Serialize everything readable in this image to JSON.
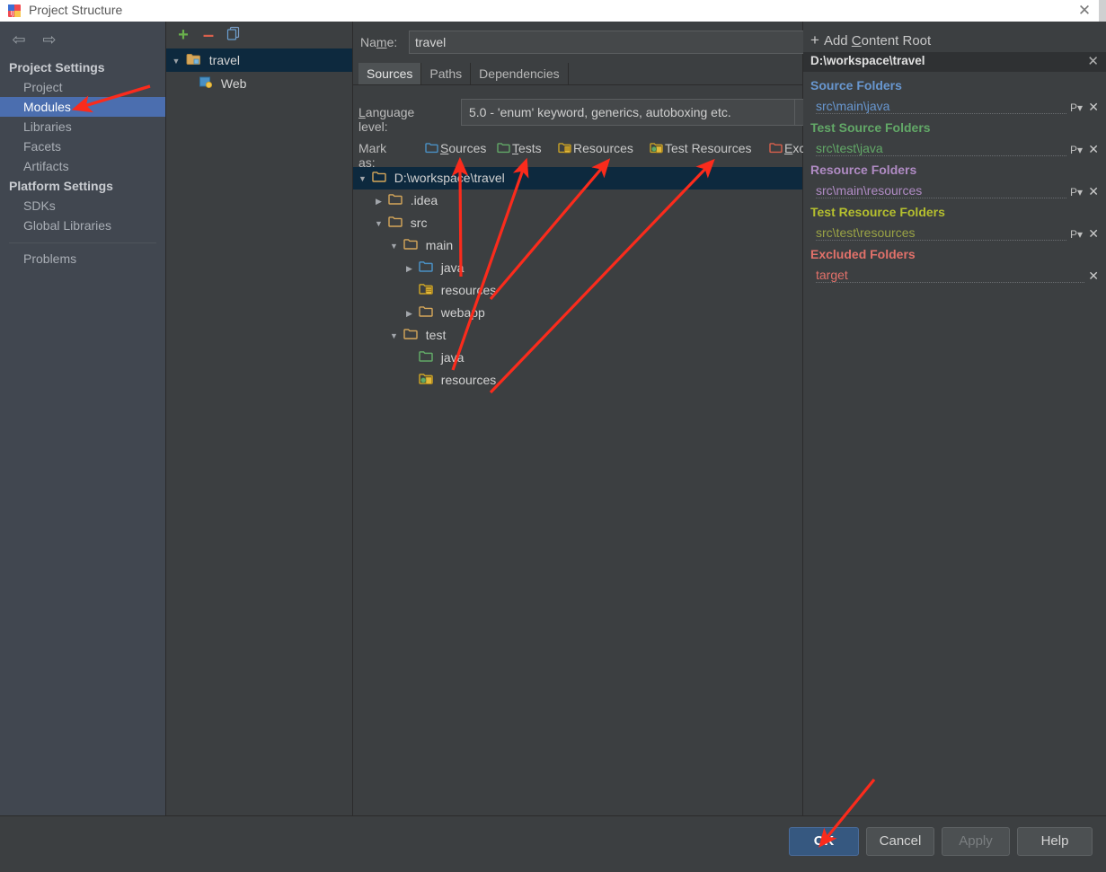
{
  "window": {
    "title": "Project Structure",
    "app_icon": "intellij-idea-icon",
    "close_label": "✕"
  },
  "nav": {
    "back_icon": "⇦",
    "forward_icon": "⇨"
  },
  "sidebar": {
    "groups": [
      {
        "label": "Project Settings",
        "items": [
          {
            "label": "Project",
            "selected": false
          },
          {
            "label": "Modules",
            "selected": true
          },
          {
            "label": "Libraries",
            "selected": false
          },
          {
            "label": "Facets",
            "selected": false
          },
          {
            "label": "Artifacts",
            "selected": false
          }
        ]
      },
      {
        "label": "Platform Settings",
        "items": [
          {
            "label": "SDKs",
            "selected": false
          },
          {
            "label": "Global Libraries",
            "selected": false
          }
        ]
      }
    ],
    "problems_label": "Problems"
  },
  "modules_panel": {
    "toolbar": {
      "add_label": "+",
      "remove_label": "–",
      "copy_label": "copy-icon"
    },
    "tree": [
      {
        "label": "travel",
        "icon": "module-folder-icon",
        "expanded": true,
        "selected": true,
        "indent": 0
      },
      {
        "label": "Web",
        "icon": "web-facet-icon",
        "expanded": null,
        "selected": false,
        "indent": 1
      }
    ]
  },
  "module_editor": {
    "name_label": "Name:",
    "name_mnemonic": "m",
    "name_value": "travel",
    "tabs": [
      {
        "label": "Sources",
        "active": true
      },
      {
        "label": "Paths",
        "active": false
      },
      {
        "label": "Dependencies",
        "active": false
      }
    ],
    "language_level": {
      "label": "Language level:",
      "value": "5.0 - 'enum' keyword, generics, autoboxing etc.",
      "arrow": "▼"
    },
    "mark_as": {
      "label": "Mark as:",
      "options": [
        {
          "label": "Sources",
          "mnemonic": "S",
          "color": "#4a90c4",
          "icon": "folder-sources-icon"
        },
        {
          "label": "Tests",
          "mnemonic": "T",
          "color": "#62a867",
          "icon": "folder-tests-icon"
        },
        {
          "label": "Resources",
          "mnemonic": "R",
          "color": "#c9a227",
          "icon": "folder-resources-icon"
        },
        {
          "label": "Test Resources",
          "mnemonic": "",
          "color": "#c9a227",
          "icon": "folder-test-resources-icon"
        },
        {
          "label": "Excluded",
          "mnemonic": "E",
          "color": "#d9604c",
          "icon": "folder-excluded-icon"
        }
      ]
    },
    "content_tree": [
      {
        "label": "D:\\workspace\\travel",
        "indent": 0,
        "expanded": true,
        "selected": true,
        "folder": "plain",
        "color": "#d2d2d2"
      },
      {
        "label": ".idea",
        "indent": 1,
        "expanded": false,
        "selected": false,
        "folder": "plain",
        "color": "#d2d2d2"
      },
      {
        "label": "src",
        "indent": 1,
        "expanded": true,
        "selected": false,
        "folder": "plain",
        "color": "#d2d2d2"
      },
      {
        "label": "main",
        "indent": 2,
        "expanded": true,
        "selected": false,
        "folder": "plain",
        "color": "#d2d2d2"
      },
      {
        "label": "java",
        "indent": 3,
        "expanded": false,
        "selected": false,
        "folder": "sources",
        "color": "#d2d2d2"
      },
      {
        "label": "resources",
        "indent": 3,
        "expanded": null,
        "selected": false,
        "folder": "resources",
        "color": "#d2d2d2"
      },
      {
        "label": "webapp",
        "indent": 3,
        "expanded": false,
        "selected": false,
        "folder": "plain",
        "color": "#d2d2d2"
      },
      {
        "label": "test",
        "indent": 2,
        "expanded": true,
        "selected": false,
        "folder": "plain",
        "color": "#d2d2d2"
      },
      {
        "label": "java",
        "indent": 3,
        "expanded": null,
        "selected": false,
        "folder": "tests",
        "color": "#d2d2d2"
      },
      {
        "label": "resources",
        "indent": 3,
        "expanded": null,
        "selected": false,
        "folder": "test-resources",
        "color": "#d2d2d2"
      }
    ]
  },
  "content_roots": {
    "add_label": "Add Content Root",
    "add_mnemonic": "C",
    "root_path": "D:\\workspace\\travel",
    "root_remove": "✕",
    "groups": [
      {
        "title": "Source Folders",
        "color": "#6897d0",
        "entries": [
          {
            "path": "src\\main\\java",
            "has_properties": true,
            "properties_label": "P",
            "remove_label": "✕"
          }
        ]
      },
      {
        "title": "Test Source Folders",
        "color": "#62a867",
        "entries": [
          {
            "path": "src\\test\\java",
            "has_properties": true,
            "properties_label": "P",
            "remove_label": "✕"
          }
        ]
      },
      {
        "title": "Resource Folders",
        "color": "#b08bc4",
        "entries": [
          {
            "path": "src\\main\\resources",
            "has_properties": true,
            "properties_label": "P",
            "remove_label": "✕"
          }
        ]
      },
      {
        "title": "Test Resource Folders",
        "color": "#b5bf2e",
        "entries": [
          {
            "path": "src\\test\\resources",
            "has_properties": true,
            "properties_label": "P",
            "remove_label": "✕"
          }
        ]
      },
      {
        "title": "Excluded Folders",
        "color": "#e2716a",
        "entries": [
          {
            "path": "target",
            "has_properties": false,
            "properties_label": "",
            "remove_label": "✕"
          }
        ]
      }
    ]
  },
  "footer": {
    "ok_label": "OK",
    "cancel_label": "Cancel",
    "apply_label": "Apply",
    "help_label": "Help",
    "apply_enabled": false
  },
  "annotations": {
    "color": "#fb2b1c",
    "arrow_count": 6
  },
  "colors": {
    "accent_selection": "#4b6eaf",
    "tree_selection": "#0d293e",
    "panel_bg": "#3c3f41",
    "sidebar_bg": "#414750",
    "ok_button": "#365880"
  }
}
